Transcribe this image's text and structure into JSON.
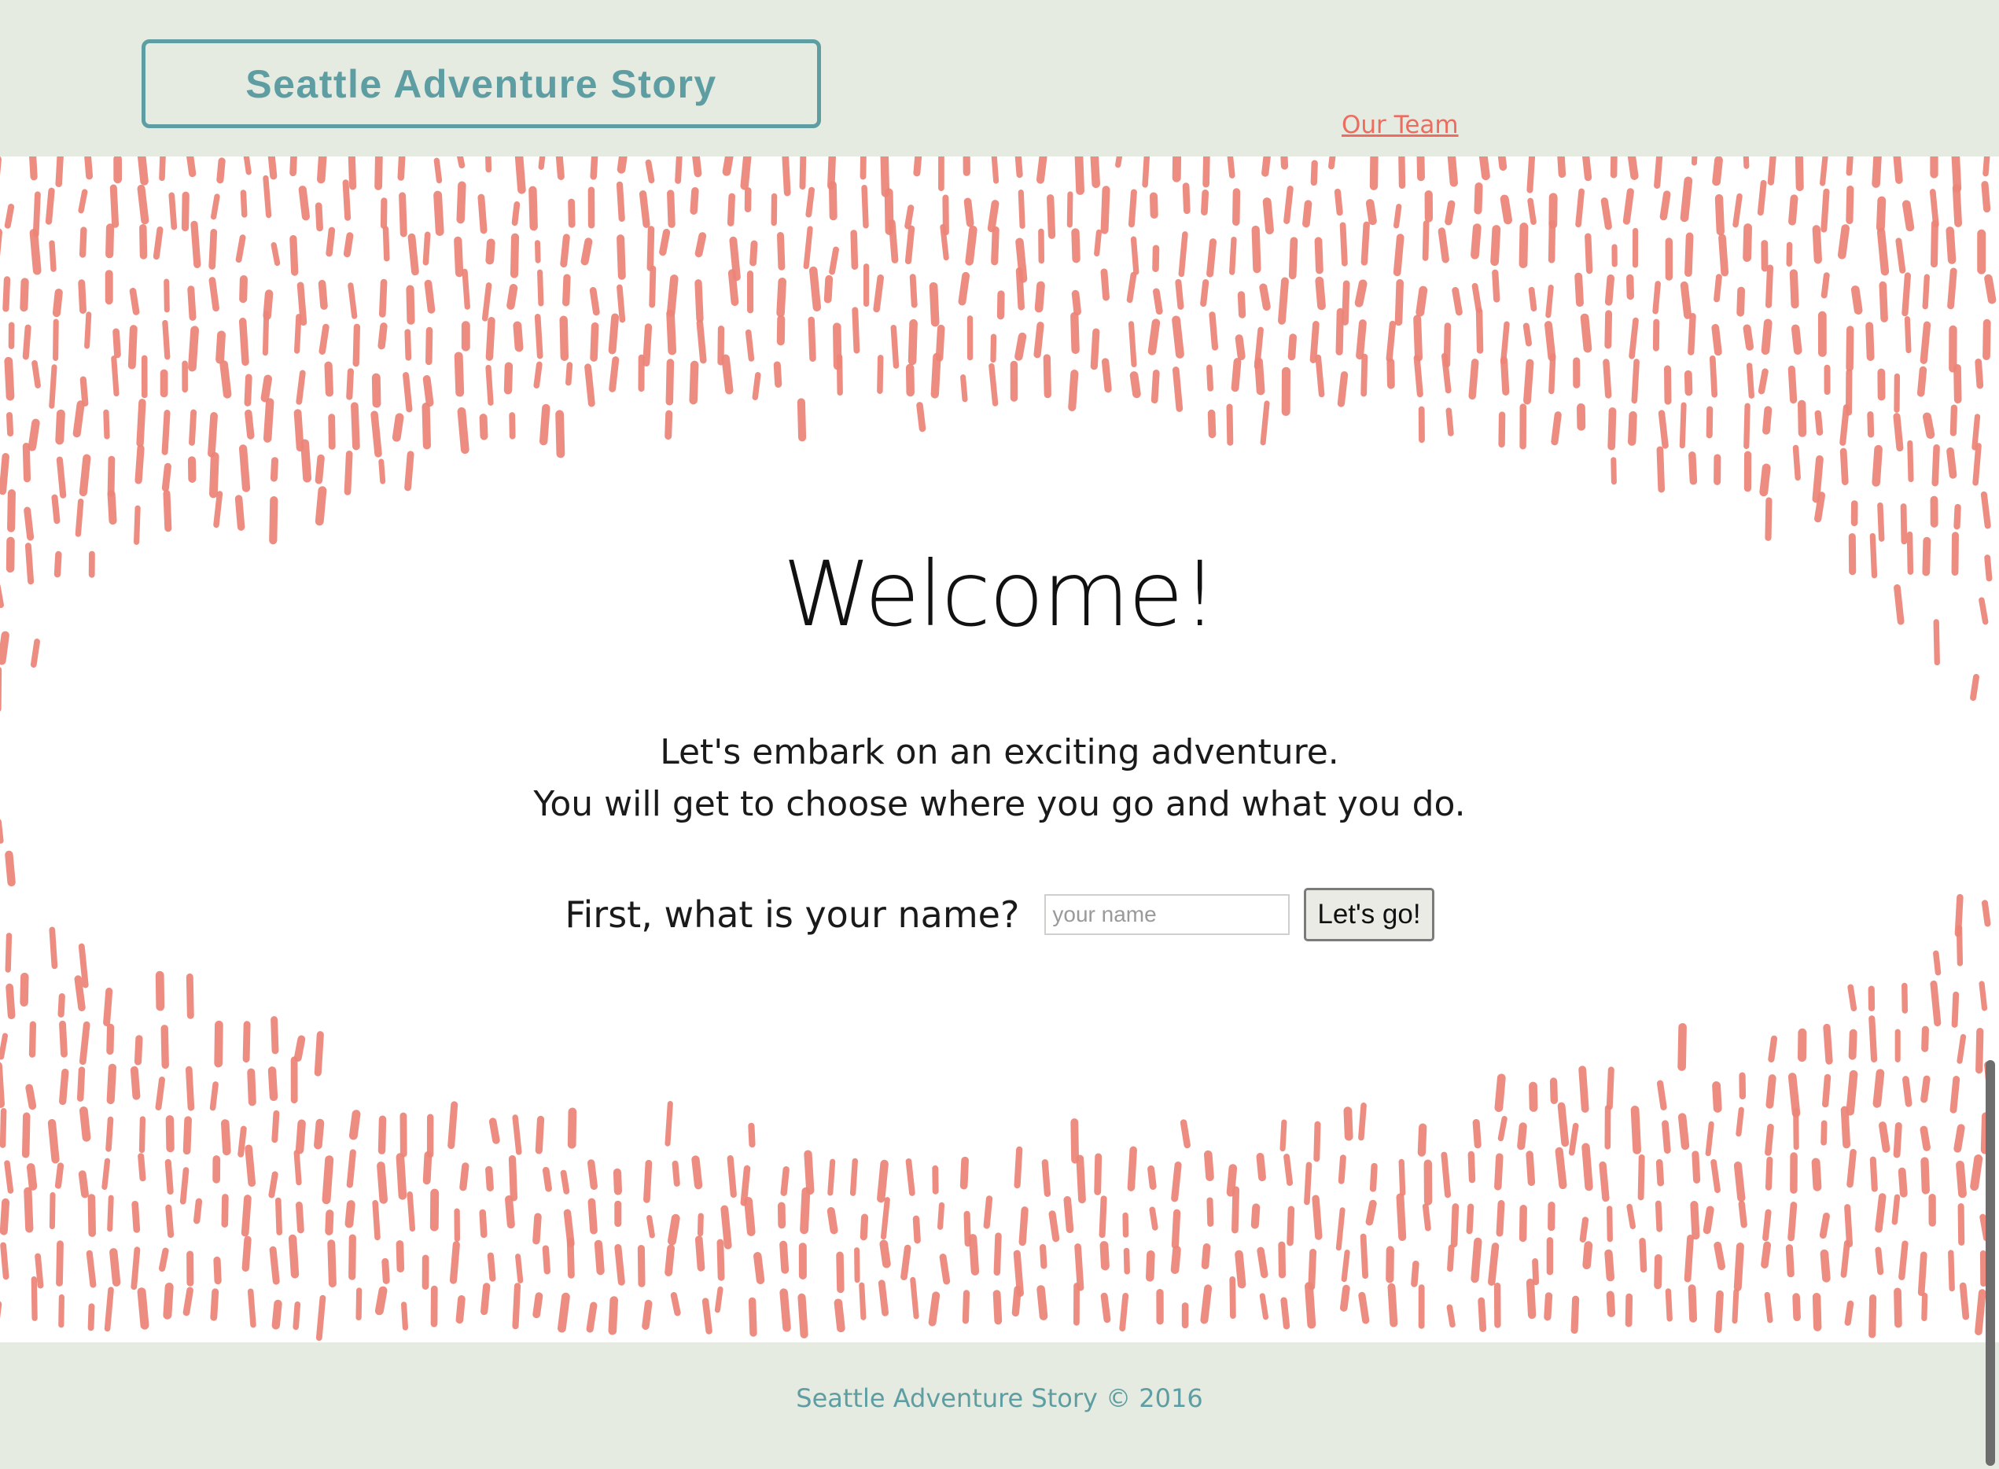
{
  "header": {
    "logo_text": "Seattle Adventure Story",
    "nav": {
      "our_team": "Our Team"
    }
  },
  "hero": {
    "title": "Welcome!",
    "intro_line_1": "Let's embark on an exciting adventure.",
    "intro_line_2": "You will get to choose where you go and what you do.",
    "name_prompt": "First, what is your name?",
    "name_input": {
      "value": "",
      "placeholder": "your name"
    },
    "submit_label": "Let's go!",
    "pattern_color": "#ec8478"
  },
  "footer": {
    "copyright": "Seattle Adventure Story © 2016"
  },
  "colors": {
    "background": "#e5ebe0",
    "accent_teal": "#5e9ea3",
    "accent_coral": "#ec6d5f"
  }
}
